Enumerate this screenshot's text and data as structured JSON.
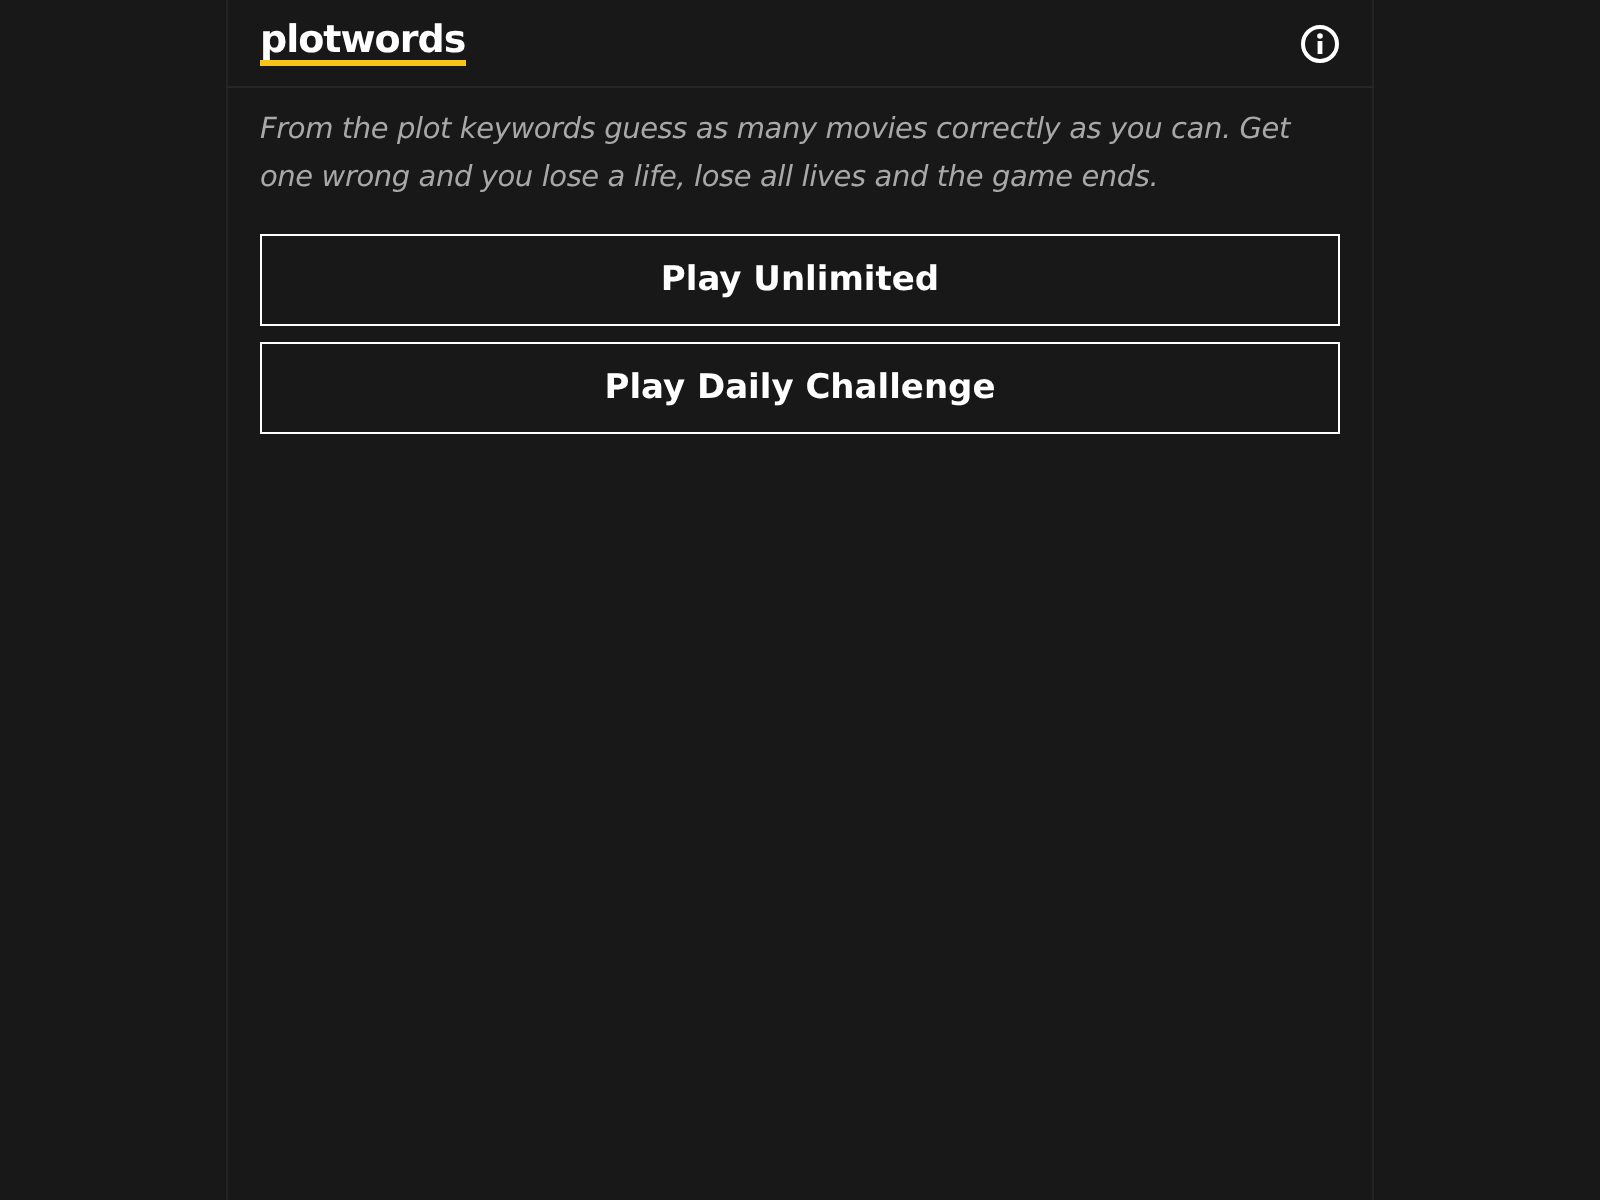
{
  "header": {
    "title": "plotwords"
  },
  "description": "From the plot keywords guess as many movies correctly as you can. Get one wrong and you lose a life, lose all lives and the game ends.",
  "buttons": [
    "Play Unlimited",
    "Play Daily Challenge"
  ]
}
